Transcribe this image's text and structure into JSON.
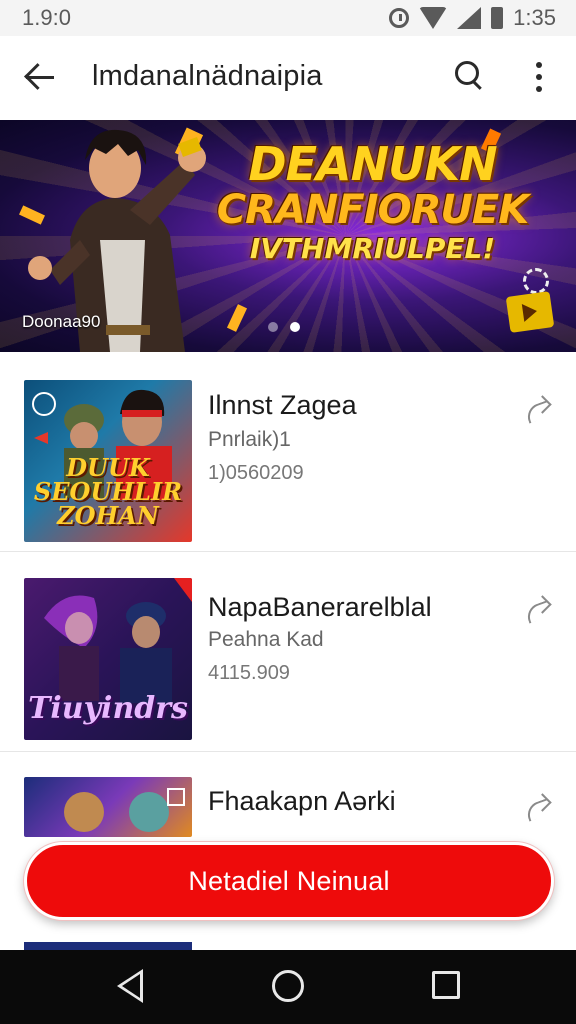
{
  "status_bar": {
    "time_left": "1.9:0",
    "time_right": "1:35"
  },
  "app_bar": {
    "title": "lmdanalnädnaipia",
    "back_icon": "arrow-back-icon",
    "search_icon": "search-icon",
    "more_icon": "more-vert-icon"
  },
  "banner": {
    "line1": "DEANUKN",
    "line2": "CRANFIORUEK",
    "line3": "IVTHMRIULPEL!",
    "caption": "Doonaa90",
    "slide_count": 2,
    "active_slide": 2,
    "colors": {
      "text": "#ffd21f",
      "bg": "#3b1677"
    }
  },
  "items": [
    {
      "name": "Ilnnst Zagea",
      "sub": "Pnrlaik)1",
      "price": "1)0560209",
      "thumb_text": "DUUK SEOUHLIR ZOHAN",
      "thumb_colors": [
        "#0c4f7a",
        "#e5382a"
      ]
    },
    {
      "name": "NapaBanerarelblal",
      "sub": "Peahna Kad",
      "price": "4115.909",
      "thumb_text": "Tiuyindrs",
      "thumb_colors": [
        "#4a1a6e",
        "#1a1440"
      ]
    },
    {
      "name": "Fhaakapn Aərki",
      "sub": "",
      "price": "",
      "thumb_text": "",
      "thumb_colors": [
        "#1c2d7a",
        "#e08a20"
      ]
    }
  ],
  "cta": {
    "label": "Netadiel Neinual",
    "color": "#ee0b0b"
  },
  "nav": {
    "back_icon": "nav-back-icon",
    "home_icon": "nav-home-icon",
    "recent_icon": "nav-recents-icon"
  }
}
